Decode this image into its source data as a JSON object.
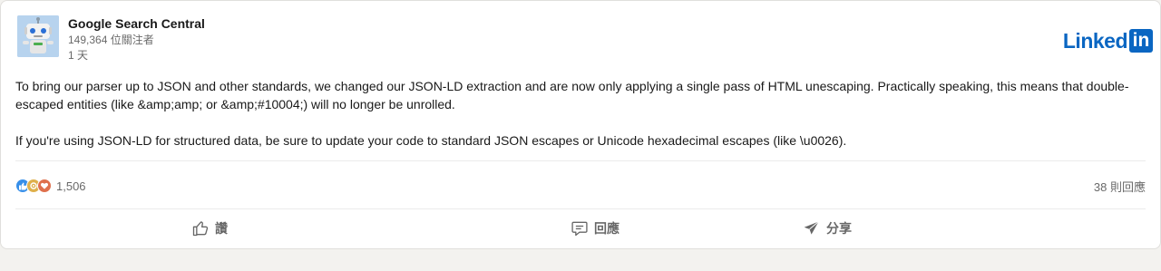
{
  "post": {
    "author": "Google Search Central",
    "followers": "149,364 位關注者",
    "time": "1 天",
    "brand": {
      "wordmark": "Linked",
      "mark": "in",
      "color": "#0a66c2"
    },
    "paragraphs": [
      "To bring our parser up to JSON and other standards, we changed our JSON-LD extraction and are now only applying a single pass of HTML unescaping. Practically speaking, this means that double-escaped entities (like &amp;amp; or &amp;#10004;) will no longer be unrolled.",
      "If you're using JSON-LD for structured data, be sure to update your code to standard JSON escapes or Unicode hexadecimal escapes (like \\u0026)."
    ]
  },
  "social": {
    "reaction_icons": [
      "like-icon",
      "celebrate-icon",
      "love-icon"
    ],
    "reaction_count": "1,506",
    "comment_count": "38 則回應"
  },
  "actions": {
    "like": {
      "label": "讚",
      "icon": "thumbs-up-icon"
    },
    "comment": {
      "label": "回應",
      "icon": "speech-bubble-icon"
    },
    "share": {
      "label": "分享",
      "icon": "paper-plane-icon"
    }
  }
}
